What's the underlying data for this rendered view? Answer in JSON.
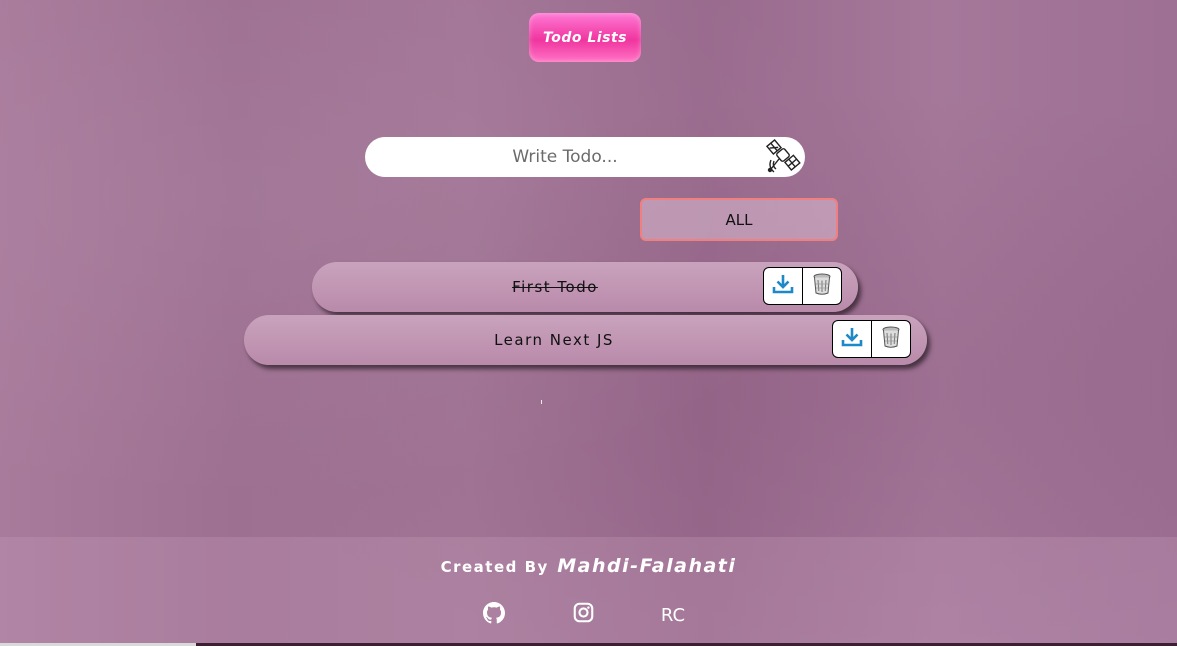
{
  "header": {
    "title": "Todo Lists"
  },
  "form": {
    "placeholder": "Write Todo...",
    "value": "",
    "submit_icon": "satellite-icon",
    "filter": {
      "selected": "ALL"
    }
  },
  "todos": [
    {
      "text": "First Todo",
      "completed": true
    },
    {
      "text": "Learn Next JS",
      "completed": false
    }
  ],
  "todo_actions": {
    "complete_icon": "download-icon",
    "delete_icon": "trash-icon"
  },
  "footer": {
    "created_by": "Created By",
    "author": "Mahdi-Falahati",
    "links": [
      {
        "icon": "github-icon"
      },
      {
        "icon": "instagram-icon"
      },
      {
        "label": "RC"
      }
    ]
  },
  "colors": {
    "accent_pink": "#f0359f",
    "select_border": "#f08080",
    "background": "#a27596",
    "icon_blue": "#1e88c8"
  }
}
